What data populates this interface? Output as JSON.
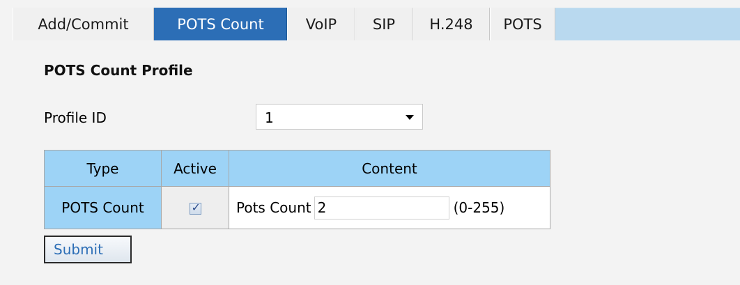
{
  "tabs": [
    {
      "label": "Add/Commit",
      "active": false
    },
    {
      "label": "POTS Count",
      "active": true
    },
    {
      "label": "VoIP",
      "active": false
    },
    {
      "label": "SIP",
      "active": false
    },
    {
      "label": "H.248",
      "active": false
    },
    {
      "label": "POTS",
      "active": false
    }
  ],
  "section": {
    "title": "POTS Count Profile"
  },
  "profile": {
    "label": "Profile ID",
    "selected_value": "1"
  },
  "table": {
    "headers": {
      "type": "Type",
      "active": "Active",
      "content": "Content"
    },
    "row": {
      "type": "POTS Count",
      "active_checked": true,
      "content_label": "Pots Count",
      "content_value": "2",
      "content_range": "(0-255)"
    }
  },
  "actions": {
    "submit_label": "Submit"
  },
  "colors": {
    "active_tab": "#2c6eb6",
    "tab_bar": "#b9d9ef",
    "table_header": "#9dd3f6",
    "page_background": "#f3f3f3"
  },
  "icons": {
    "dropdown": "chevron-down-icon",
    "checkbox": "checkbox-checked-icon"
  }
}
